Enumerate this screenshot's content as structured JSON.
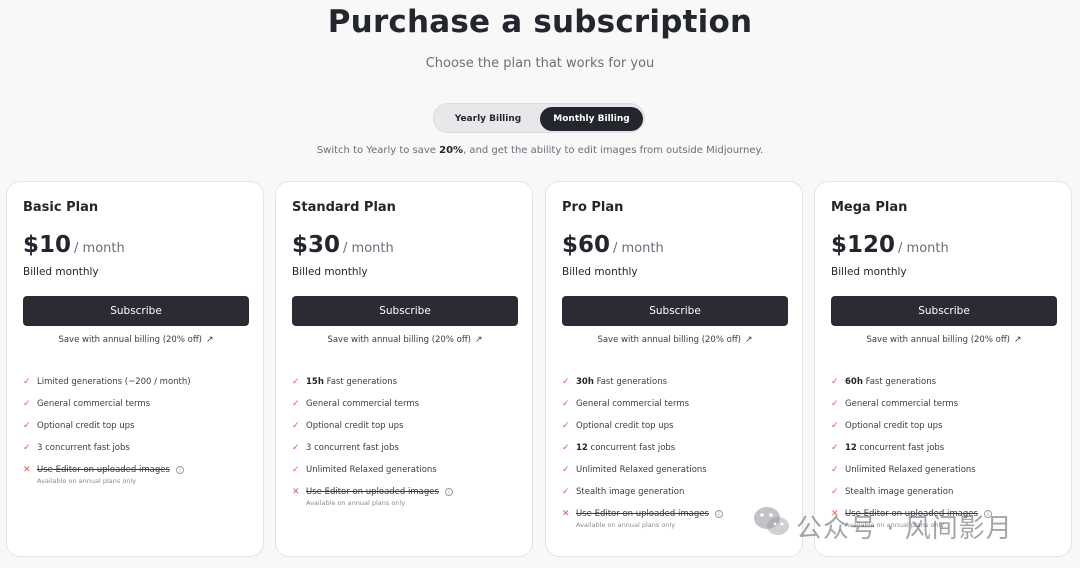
{
  "header": {
    "title": "Purchase a subscription",
    "subtitle": "Choose the plan that works for you"
  },
  "billing_toggle": {
    "yearly_label": "Yearly Billing",
    "monthly_label": "Monthly Billing",
    "selected": "Monthly Billing"
  },
  "note": {
    "prefix": "Switch to Yearly to save ",
    "highlight": "20%",
    "suffix": ", and get the ability to edit images from outside Midjourney."
  },
  "plans": [
    {
      "name": "Basic Plan",
      "price": "$10",
      "period": "/ month",
      "billed": "Billed monthly",
      "button": "Subscribe",
      "save_link": "Save with annual billing (20% off)",
      "features": [
        {
          "bold": "",
          "text": "Limited generations (~200 / month)"
        },
        {
          "bold": "",
          "text": "General commercial terms"
        },
        {
          "bold": "",
          "text": "Optional credit top ups"
        },
        {
          "bold": "",
          "text": "3 concurrent fast jobs"
        }
      ],
      "struck": {
        "text": "Use Editor on uploaded images",
        "hint": "Available on annual plans only"
      }
    },
    {
      "name": "Standard Plan",
      "price": "$30",
      "period": "/ month",
      "billed": "Billed monthly",
      "button": "Subscribe",
      "save_link": "Save with annual billing (20% off)",
      "features": [
        {
          "bold": "15h",
          "text": " Fast generations"
        },
        {
          "bold": "",
          "text": "General commercial terms"
        },
        {
          "bold": "",
          "text": "Optional credit top ups"
        },
        {
          "bold": "",
          "text": "3 concurrent fast jobs"
        },
        {
          "bold": "",
          "text": "Unlimited Relaxed generations"
        }
      ],
      "struck": {
        "text": "Use Editor on uploaded images",
        "hint": "Available on annual plans only"
      }
    },
    {
      "name": "Pro Plan",
      "price": "$60",
      "period": "/ month",
      "billed": "Billed monthly",
      "button": "Subscribe",
      "save_link": "Save with annual billing (20% off)",
      "features": [
        {
          "bold": "30h",
          "text": " Fast generations"
        },
        {
          "bold": "",
          "text": "General commercial terms"
        },
        {
          "bold": "",
          "text": "Optional credit top ups"
        },
        {
          "bold": "12",
          "text": " concurrent fast jobs"
        },
        {
          "bold": "",
          "text": "Unlimited Relaxed generations"
        },
        {
          "bold": "",
          "text": "Stealth image generation"
        }
      ],
      "struck": {
        "text": "Use Editor on uploaded images",
        "hint": "Available on annual plans only"
      }
    },
    {
      "name": "Mega Plan",
      "price": "$120",
      "period": "/ month",
      "billed": "Billed monthly",
      "button": "Subscribe",
      "save_link": "Save with annual billing (20% off)",
      "features": [
        {
          "bold": "60h",
          "text": " Fast generations"
        },
        {
          "bold": "",
          "text": "General commercial terms"
        },
        {
          "bold": "",
          "text": "Optional credit top ups"
        },
        {
          "bold": "12",
          "text": " concurrent fast jobs"
        },
        {
          "bold": "",
          "text": "Unlimited Relaxed generations"
        },
        {
          "bold": "",
          "text": "Stealth image generation"
        }
      ],
      "struck": {
        "text": "Use Editor on uploaded images",
        "hint": "Available on annual plans only"
      }
    }
  ],
  "icons": {
    "check": "✓",
    "cross": "✕",
    "arrow": "↗",
    "info": "i"
  },
  "colors": {
    "accent": "#e4564c",
    "dark": "#24262e",
    "background": "#f8f8f9"
  },
  "watermark": {
    "text": "公众号 · 风间影月"
  }
}
